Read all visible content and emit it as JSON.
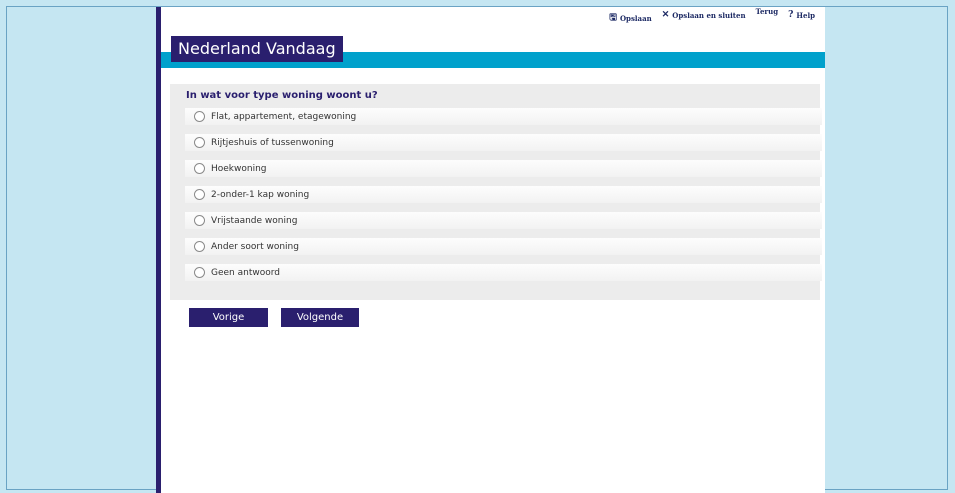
{
  "toplinks": {
    "save": "Opslaan",
    "save_close": "Opslaan en sluiten",
    "back": "Terug",
    "help": "Help"
  },
  "header": {
    "title": "Nederland Vandaag"
  },
  "survey": {
    "question": "In wat voor type woning woont u?",
    "options": [
      "Flat, appartement, etagewoning",
      "Rijtjeshuis of tussenwoning",
      "Hoekwoning",
      "2-onder-1 kap woning",
      "Vrijstaande woning",
      "Ander soort woning",
      "Geen antwoord"
    ]
  },
  "nav": {
    "prev": "Vorige",
    "next": "Volgende"
  },
  "colors": {
    "brand": "#2a1f6e",
    "accent": "#00a1cc",
    "background": "#c5e6f2"
  }
}
